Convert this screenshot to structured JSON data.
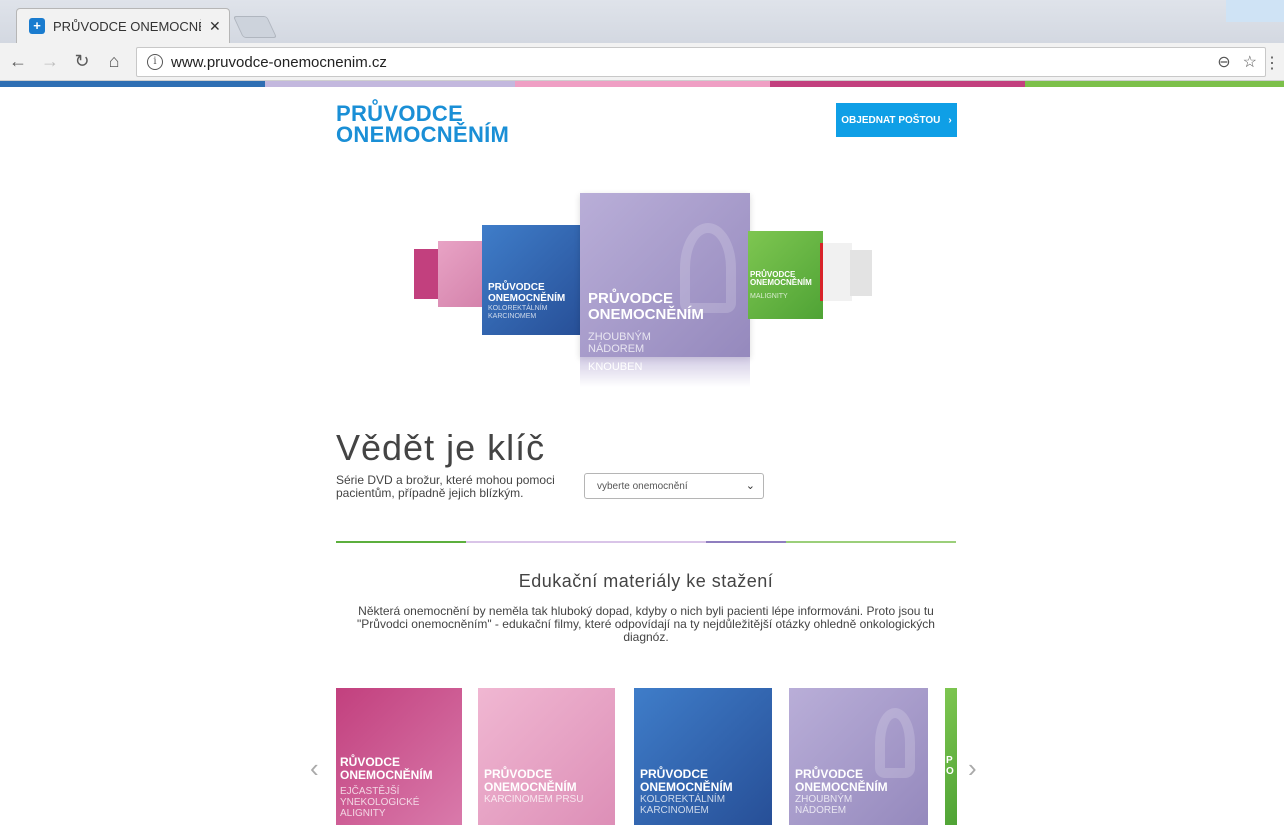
{
  "browser": {
    "tab_title": "PRŮVODCE ONEMOCNĚNÍ",
    "tab_close": "✕",
    "url": "www.pruvodce-onemocnenim.cz"
  },
  "colors": {
    "brand_blue": "#1a8fd6",
    "button_blue": "#0f9fe6",
    "pink": "#c2407e",
    "light_pink": "#e8a3c5",
    "blue": "#2e63ad",
    "lavender": "#a89bc9",
    "green": "#5caf3d"
  },
  "header": {
    "logo_line1": "PRŮVODCE",
    "logo_line2": "ONEMOCNĚNÍM",
    "order_button": "OBJEDNAT POŠTOU",
    "order_arrow": "›"
  },
  "carousel": {
    "covers": [
      {
        "title": "PRŮVODCE ONEMOCNĚNÍM",
        "subtitle": "ZHOUBNÝM NÁDOREM",
        "reflection": "KNOUBEN"
      },
      {
        "title": "PRŮVODCE ONEMOCNĚNÍM",
        "subtitle": "KOLOREKTÁLNÍM KARCINOMEM"
      },
      {
        "title": "PRŮVODCE ONEMOCNĚNÍM",
        "subtitle": "MALIGNITY"
      }
    ]
  },
  "intro_section": {
    "heading": "Vědět je klíč",
    "subtext": "Série DVD a brožur, které mohou pomoci pacientům, případně jejich blízkým.",
    "select_placeholder": "vyberte onemocnění"
  },
  "downloads": {
    "title": "Edukační materiály ke stažení",
    "text": "Některá onemocnění by neměla tak hluboký dopad, kdyby o nich byli pacienti lépe informováni. Proto jsou tu \"Průvodci onemocněním\" - edukační filmy, které odpovídají na ty nejdůležitější otázky ohledně onkologických diagnóz.",
    "prev": "‹",
    "next": "›",
    "items": [
      {
        "title_l1": "RŮVODCE",
        "title_l2": "ONEMOCNĚNÍM",
        "subtitle": "EJČASTĚJŠÍ YNEKOLOGICKÉ ALIGNITY"
      },
      {
        "title_l1": "PRŮVODCE",
        "title_l2": "ONEMOCNĚNÍM",
        "subtitle": "KARCINOMEM PRSU"
      },
      {
        "title_l1": "PRŮVODCE",
        "title_l2": "ONEMOCNĚNÍM",
        "subtitle": "KOLOREKTÁLNÍM KARCINOMEM"
      },
      {
        "title_l1": "PRŮVODCE",
        "title_l2": "ONEMOCNĚNÍM",
        "subtitle": "ZHOUBNÝM NÁDOREM"
      },
      {
        "title_l1": "P",
        "title_l2": "O",
        "subtitle": ""
      }
    ]
  }
}
